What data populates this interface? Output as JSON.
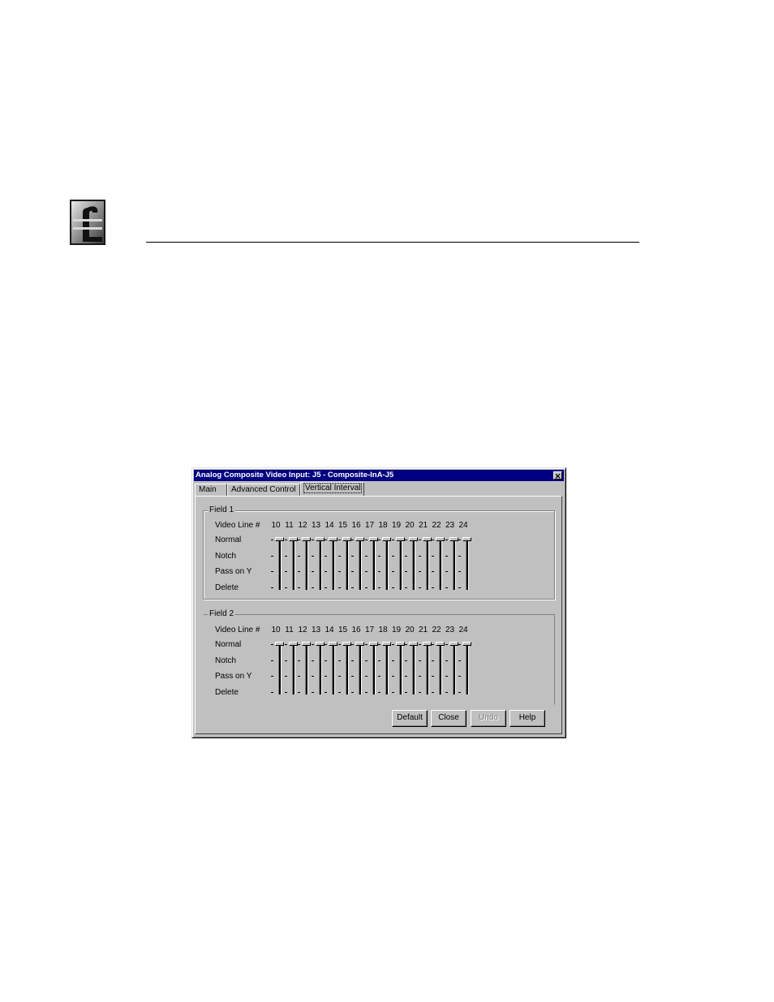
{
  "dialog": {
    "title": "Analog Composite Video Input: J5 - Composite-InA-J5",
    "close_glyph": "✕",
    "tabs": [
      {
        "label": "Main",
        "active": false
      },
      {
        "label": "Advanced Control",
        "active": false
      },
      {
        "label": "Vertical Interval",
        "active": true
      }
    ],
    "field1": {
      "label": "Field 1",
      "header_label": "Video Line #",
      "rows": [
        "Normal",
        "Notch",
        "Pass on Y",
        "Delete"
      ],
      "lines": [
        "10",
        "11",
        "12",
        "13",
        "14",
        "15",
        "16",
        "17",
        "18",
        "19",
        "20",
        "21",
        "22",
        "23",
        "24"
      ],
      "settings": [
        "Normal",
        "Normal",
        "Normal",
        "Normal",
        "Normal",
        "Normal",
        "Normal",
        "Normal",
        "Normal",
        "Normal",
        "Normal",
        "Normal",
        "Normal",
        "Normal",
        "Normal"
      ]
    },
    "field2": {
      "label": "Field 2",
      "header_label": "Video Line #",
      "rows": [
        "Normal",
        "Notch",
        "Pass on Y",
        "Delete"
      ],
      "lines": [
        "10",
        "11",
        "12",
        "13",
        "14",
        "15",
        "16",
        "17",
        "18",
        "19",
        "20",
        "21",
        "22",
        "23",
        "24"
      ],
      "settings": [
        "Normal",
        "Normal",
        "Normal",
        "Normal",
        "Normal",
        "Normal",
        "Normal",
        "Normal",
        "Normal",
        "Normal",
        "Normal",
        "Normal",
        "Normal",
        "Normal",
        "Normal"
      ]
    },
    "buttons": {
      "default": "Default",
      "close": "Close",
      "undo": "Undo",
      "help": "Help"
    }
  },
  "icons": {
    "logo": "company-logo-icon"
  }
}
